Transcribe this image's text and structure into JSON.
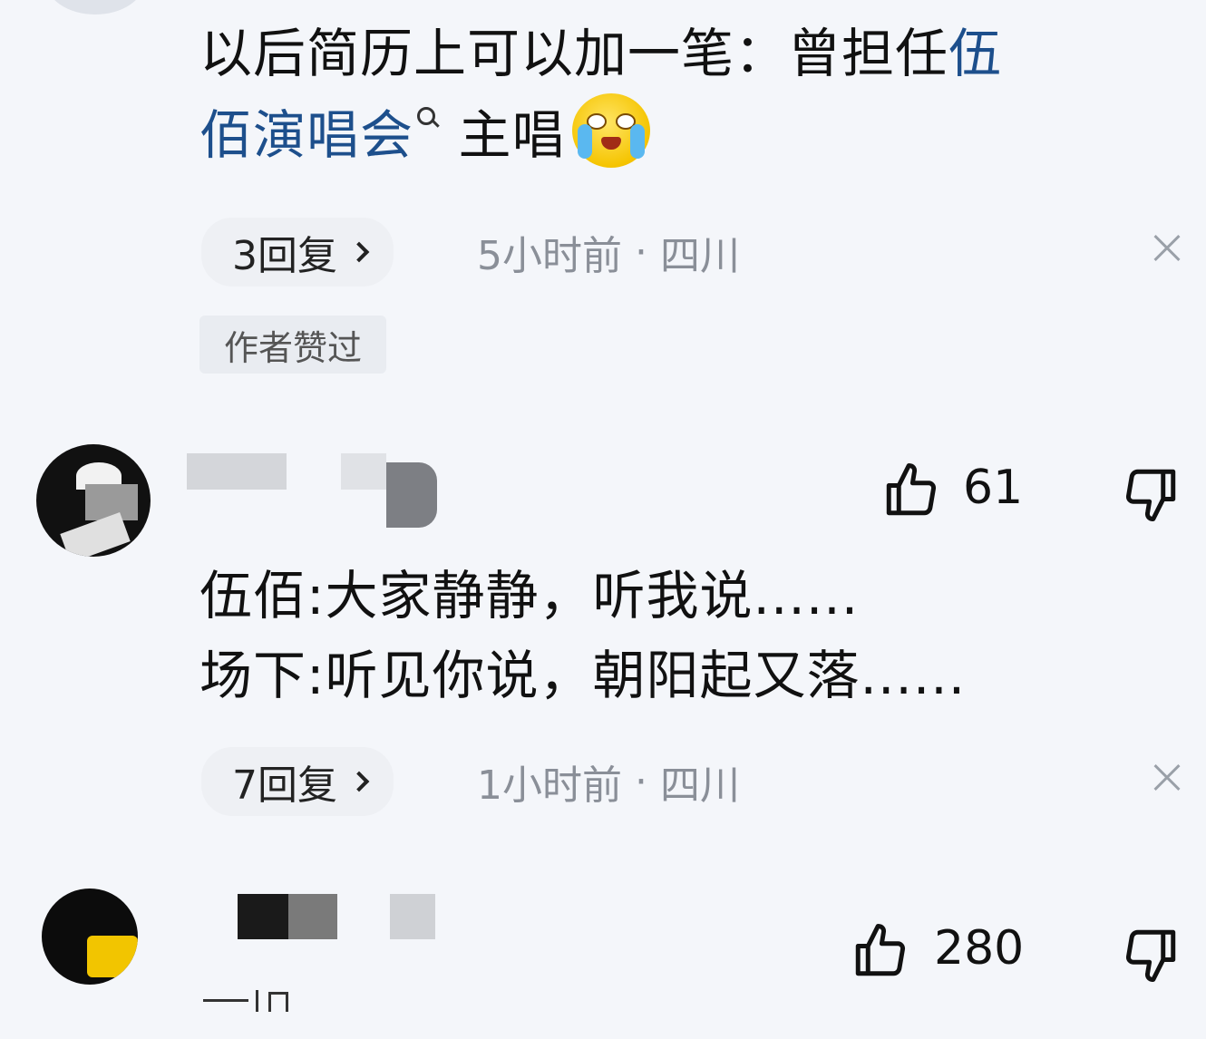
{
  "comments": [
    {
      "text_line1_pre": "以后简历上可以加一笔：曾担任",
      "text_line1_link": "伍",
      "text_line2_link": "佰演唱会",
      "text_line2_post": "主唱",
      "emoji": "crying-laughing-emoji",
      "reply_count": "3回复",
      "time": "5小时前",
      "location": "四川",
      "badge": "作者赞过"
    },
    {
      "likes": "61",
      "line1": "伍佰:大家静静，听我说......",
      "line2": "场下:听见你说，朝阳起又落......",
      "reply_count": "7回复",
      "time": "1小时前",
      "location": "四川"
    },
    {
      "likes": "280"
    }
  ],
  "separator": "·",
  "icons": [
    "search-icon",
    "chevron-right-icon",
    "close-icon",
    "thumbs-up-icon",
    "thumbs-down-icon"
  ]
}
